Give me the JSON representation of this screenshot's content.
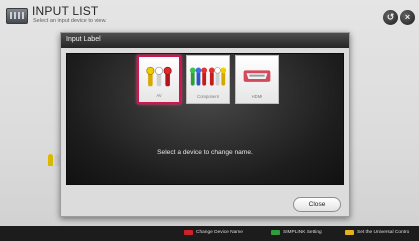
{
  "header": {
    "title": "INPUT LIST",
    "subtitle": "Select an input device to view."
  },
  "dialog": {
    "title": "Input Label",
    "devices": [
      {
        "label": "AV",
        "icon": "av-rca-cable-icon",
        "selected": true
      },
      {
        "label": "Component",
        "icon": "component-cable-icon",
        "selected": false
      },
      {
        "label": "HDMI",
        "icon": "hdmi-port-icon",
        "selected": false
      }
    ],
    "prompt": "Select a device to change name.",
    "close_label": "Close"
  },
  "bottom_bar": {
    "items": [
      {
        "key_color": "#d0202a",
        "label": "Change Device Name"
      },
      {
        "key_color": "#2f9e3a",
        "label": "SIMPLINK Setting"
      },
      {
        "key_color": "#e6b219",
        "label": "Set the Universal Contro"
      }
    ]
  },
  "colors": {
    "accent_selected": "#c8184e",
    "titlebar": "#2e2e2e",
    "bottom_bar": "#1c1c1c"
  }
}
